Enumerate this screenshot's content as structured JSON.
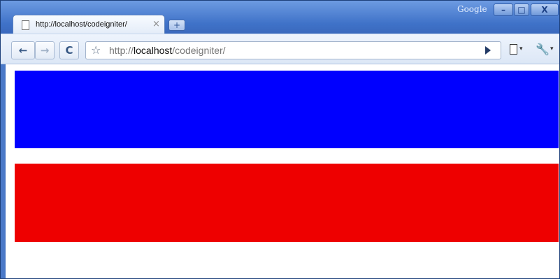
{
  "window": {
    "brand": "Google",
    "controls": {
      "minimize": "–",
      "maximize": "□",
      "close": "X"
    }
  },
  "tab": {
    "title": "http://localhost/codeigniter/",
    "close": "×"
  },
  "new_tab": "+",
  "toolbar": {
    "back": "←",
    "forward": "→",
    "reload": "C",
    "star": "☆",
    "url_prefix": "http://",
    "url_host": "localhost",
    "url_path": "/codeigniter/",
    "page_menu_arrow": "▾",
    "wrench": "🔧",
    "wrench_menu_arrow": "▾"
  },
  "page": {
    "bands": [
      {
        "color": "#0000ff"
      },
      {
        "color": "#ee0000"
      }
    ]
  }
}
